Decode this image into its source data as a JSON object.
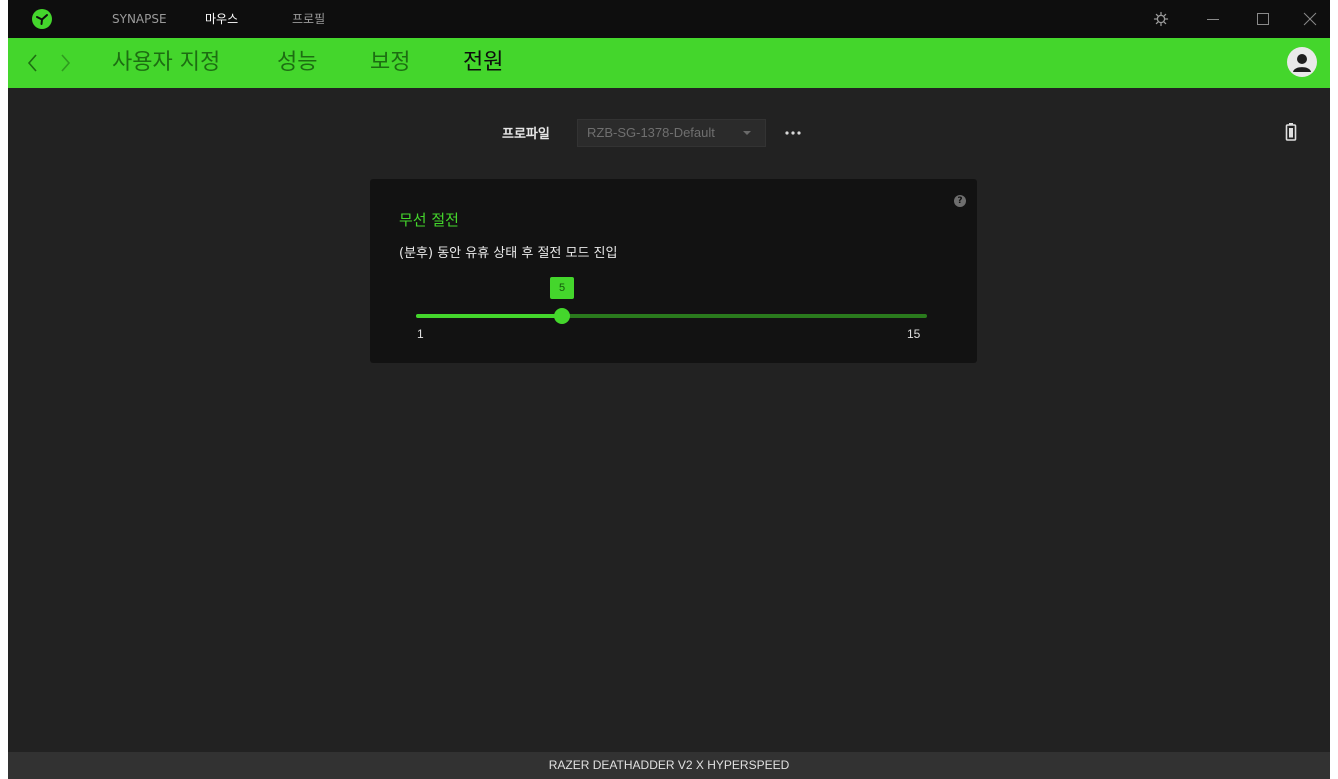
{
  "titlebar": {
    "nav": [
      {
        "label": "SYNAPSE",
        "active": false
      },
      {
        "label": "마우스",
        "active": true
      },
      {
        "label": "프로필",
        "active": false
      }
    ],
    "controls": [
      "settings-icon",
      "minimize-icon",
      "maximize-icon",
      "close-icon"
    ]
  },
  "subnav": {
    "tabs": [
      {
        "label": "사용자 지정",
        "active": false
      },
      {
        "label": "성능",
        "active": false
      },
      {
        "label": "보정",
        "active": false
      },
      {
        "label": "전원",
        "active": true
      }
    ]
  },
  "profile": {
    "label": "프로파일",
    "selected": "RZB-SG-1378-Default"
  },
  "power_card": {
    "title": "무선 절전",
    "description": "(분후) 동안 유휴 상태 후 절전 모드 진입",
    "slider": {
      "min": 1,
      "max": 15,
      "value": 5,
      "min_label": "1",
      "max_label": "15",
      "value_label": "5"
    }
  },
  "footer": {
    "device_name": "RAZER DEATHADDER V2 X HYPERSPEED"
  },
  "colors": {
    "accent": "#44d62c",
    "background": "#222222",
    "titlebar": "#0e0e0e",
    "card": "#121212"
  }
}
